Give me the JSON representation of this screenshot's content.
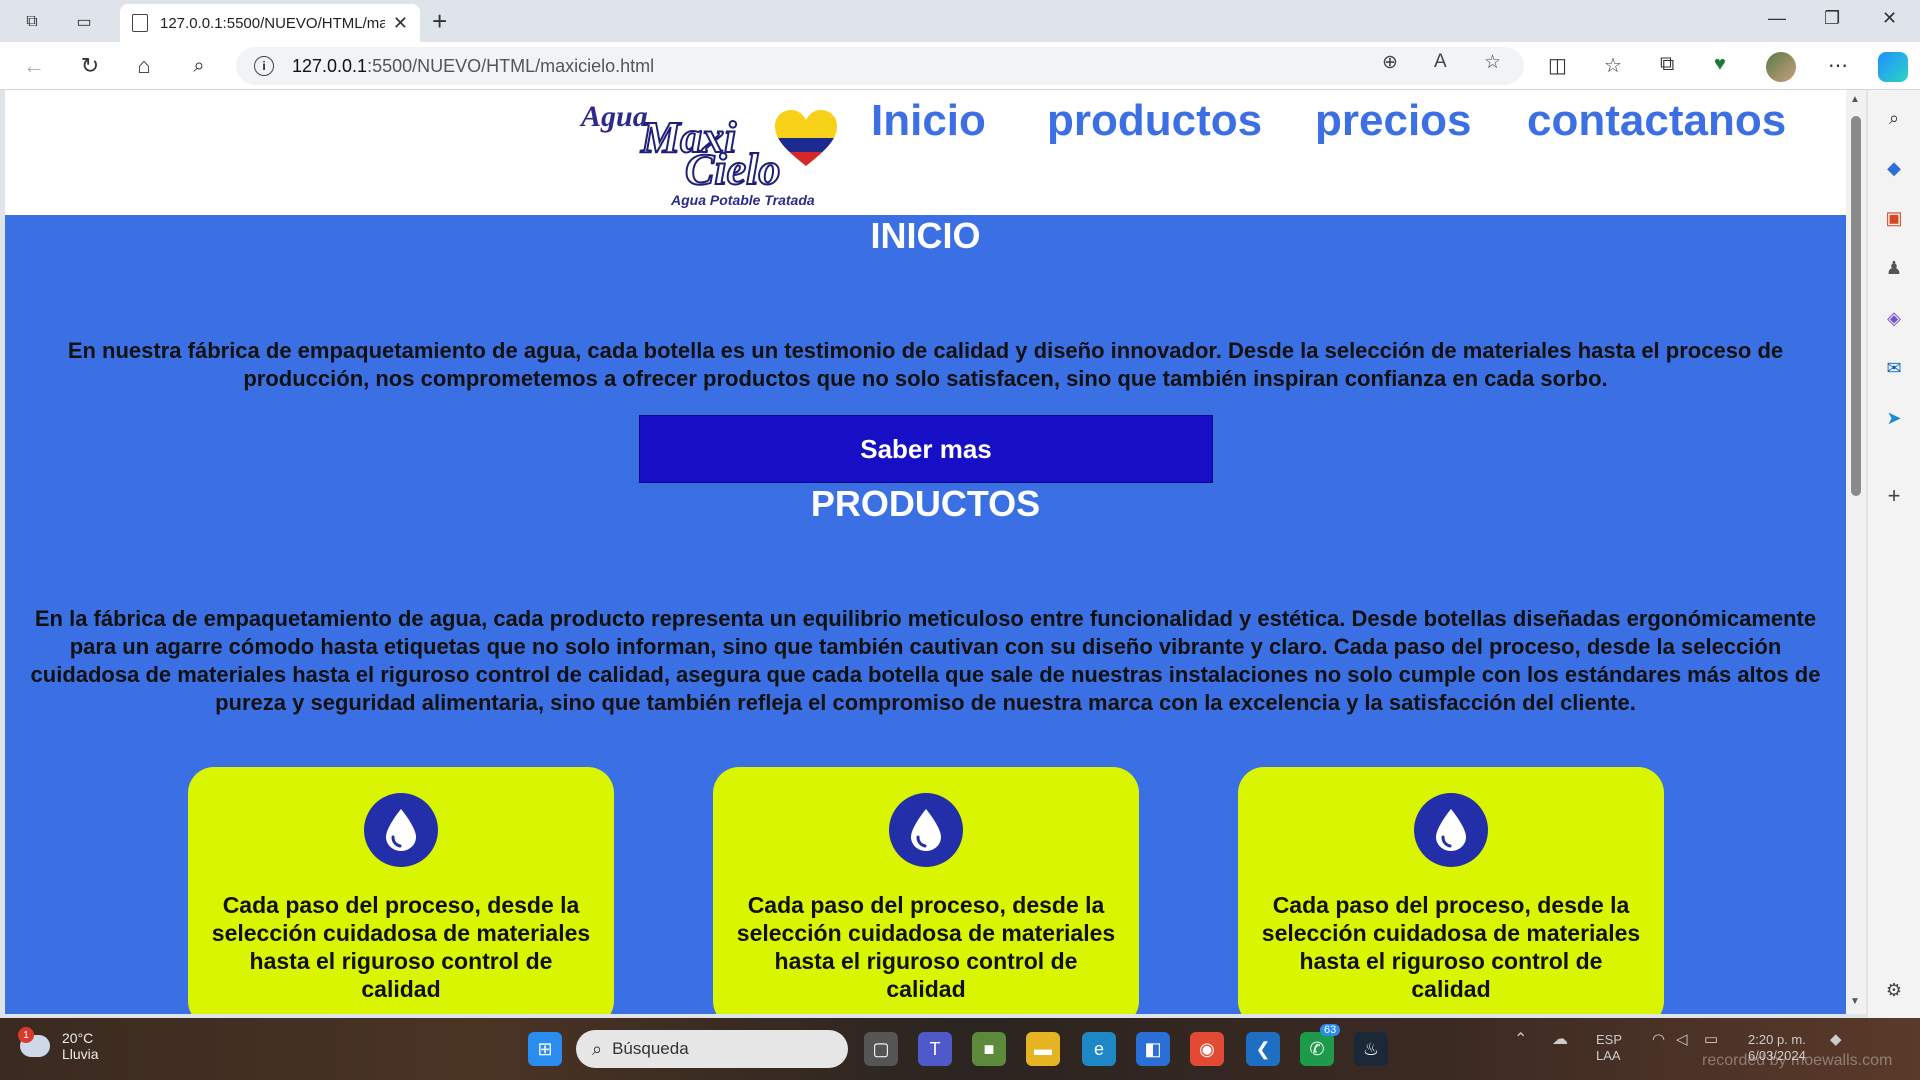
{
  "browser": {
    "tab_title": "127.0.0.1:5500/NUEVO/HTML/ma",
    "url_host": "127.0.0.1",
    "url_path": ":5500/NUEVO/HTML/maxicielo.html"
  },
  "site": {
    "logo": {
      "agua": "Agua",
      "maxi": "Maxi",
      "cielo": "Cielo",
      "tagline": "Agua Potable Tratada"
    },
    "nav": [
      "Inicio",
      "productos",
      "precios",
      "contactanos"
    ]
  },
  "sections": {
    "inicio": {
      "title": "INICIO",
      "text": "En nuestra fábrica de empaquetamiento de agua, cada botella es un testimonio de calidad y diseño innovador. Desde la selección de materiales hasta el proceso de producción, nos comprometemos a ofrecer productos que no solo satisfacen, sino que también inspiran confianza en cada sorbo.",
      "button": "Saber mas"
    },
    "productos": {
      "title": "PRODUCTOS",
      "text": "En la fábrica de empaquetamiento de agua, cada producto representa un equilibrio meticuloso entre funcionalidad y estética. Desde botellas diseñadas ergonómicamente para un agarre cómodo hasta etiquetas que no solo informan, sino que también cautivan con su diseño vibrante y claro. Cada paso del proceso, desde la selección cuidadosa de materiales hasta el riguroso control de calidad, asegura que cada botella que sale de nuestras instalaciones no solo cumple con los estándares más altos de pureza y seguridad alimentaria, sino que también refleja el compromiso de nuestra marca con la excelencia y la satisfacción del cliente.",
      "cards": [
        {
          "icon": "water-drop-icon",
          "text": "Cada paso del proceso, desde la selección cuidadosa de materiales hasta el riguroso control de calidad"
        },
        {
          "icon": "water-drop-icon",
          "text": "Cada paso del proceso, desde la selección cuidadosa de materiales hasta el riguroso control de calidad"
        },
        {
          "icon": "water-drop-icon",
          "text": "Cada paso del proceso, desde la selección cuidadosa de materiales hasta el riguroso control de calidad"
        }
      ]
    }
  },
  "taskbar": {
    "weather_temp": "20°C",
    "weather_desc": "Lluvia",
    "weather_badge": "1",
    "search_placeholder": "Búsqueda",
    "whatsapp_badge": "63",
    "lang_1": "ESP",
    "lang_2": "LAA",
    "time": "2:20 p. m.",
    "date": "6/03/2024",
    "watermark": "recorded by moewalls.com"
  },
  "colors": {
    "page_bg": "#3b70e4",
    "nav_link": "#3c6fe3",
    "button_bg": "#170fc6",
    "card_bg": "#d9f500",
    "icon_circle": "#232fa8"
  }
}
